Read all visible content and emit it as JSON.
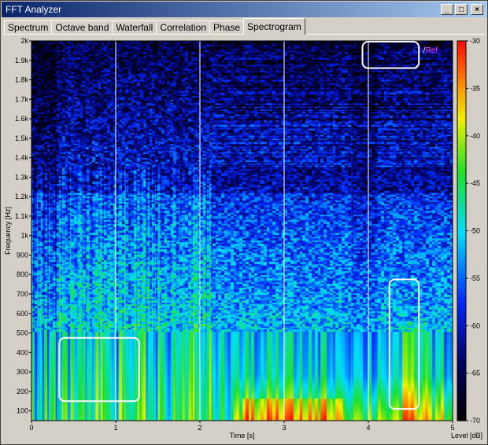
{
  "window": {
    "title": "FFT Analyzer",
    "minimize": "_",
    "restore": "□",
    "close": "×"
  },
  "tabs": [
    {
      "label": "Spectrum"
    },
    {
      "label": "Octave band"
    },
    {
      "label": "Waterfall"
    },
    {
      "label": "Correlation"
    },
    {
      "label": "Phase"
    },
    {
      "label": "Spectrogram",
      "active": true
    }
  ],
  "overlay": {
    "channel": "Ch",
    "sep": "/",
    "ref": "Ref"
  },
  "chart_data": {
    "type": "heatmap",
    "xlabel": "Time [s]",
    "ylabel": "Frequency [Hz]",
    "colorbar_label": "Level [dB]",
    "xlim": [
      0,
      5
    ],
    "ylim": [
      50,
      2000
    ],
    "x_ticks": [
      "0",
      "1",
      "2",
      "3",
      "4",
      "5"
    ],
    "y_ticks": [
      "100",
      "200",
      "300",
      "400",
      "500",
      "600",
      "700",
      "800",
      "900",
      "1k",
      "1.1k",
      "1.2k",
      "1.3k",
      "1.4k",
      "1.5k",
      "1.6k",
      "1.7k",
      "1.8k",
      "1.9k",
      "2k"
    ],
    "colorbar_ticks": [
      "-30",
      "-35",
      "-40",
      "-45",
      "-50",
      "-55",
      "-60",
      "-65",
      "-70"
    ],
    "colorbar_range": [
      -70,
      -30
    ],
    "colors": {
      "low": "#000000",
      "blue": "#0010ff",
      "cyan": "#00e0ff",
      "green": "#20e020",
      "yellow": "#f0f000",
      "red": "#ff1000"
    }
  }
}
